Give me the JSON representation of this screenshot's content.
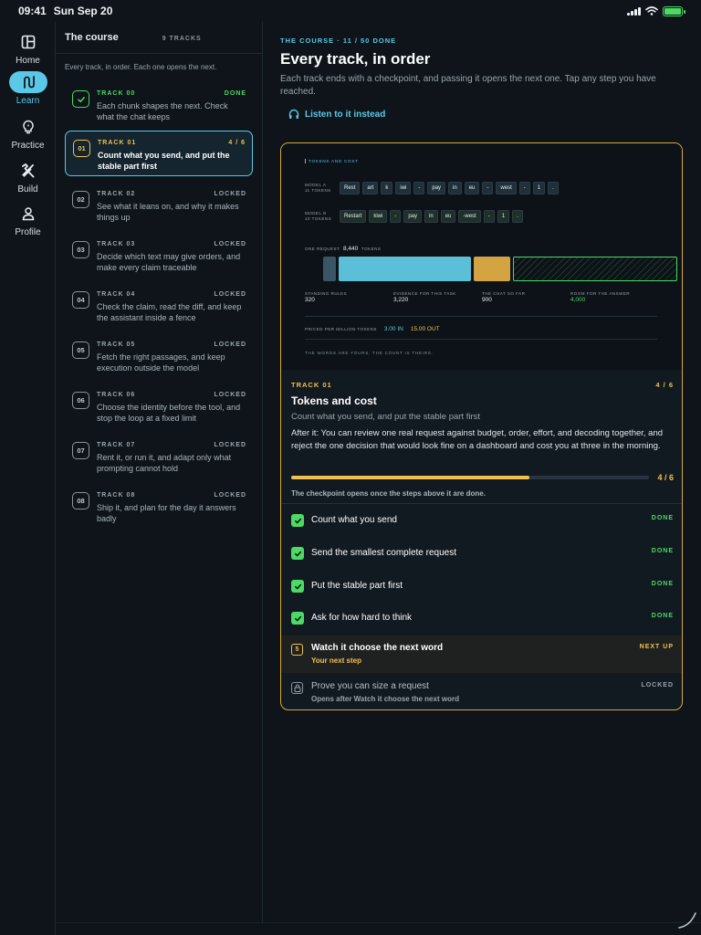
{
  "status": {
    "time": "09:41",
    "date": "Sun Sep 20"
  },
  "nav": [
    {
      "label": "Home",
      "icon": "layout-icon"
    },
    {
      "label": "Learn",
      "icon": "path-icon",
      "active": true
    },
    {
      "label": "Practice",
      "icon": "lightbulb-icon"
    },
    {
      "label": "Build",
      "icon": "tools-icon"
    },
    {
      "label": "Profile",
      "icon": "person-icon"
    }
  ],
  "course": {
    "title": "The course",
    "count": "9 TRACKS",
    "intro": "Every track, in order. Each one opens the next.",
    "tracks": [
      {
        "badge": "",
        "kicker": "TRACK 00",
        "state": "DONE",
        "desc": "Each chunk shapes the next. Check what the chat keeps",
        "status": "done"
      },
      {
        "badge": "01",
        "kicker": "TRACK 01",
        "state": "4 / 6",
        "desc": "Count what you send, and put the stable part first",
        "status": "current"
      },
      {
        "badge": "02",
        "kicker": "TRACK 02",
        "state": "LOCKED",
        "desc": "See what it leans on, and why it makes things up",
        "status": "locked"
      },
      {
        "badge": "03",
        "kicker": "TRACK 03",
        "state": "LOCKED",
        "desc": "Decide which text may give orders, and make every claim traceable",
        "status": "locked"
      },
      {
        "badge": "04",
        "kicker": "TRACK 04",
        "state": "LOCKED",
        "desc": "Check the claim, read the diff, and keep the assistant inside a fence",
        "status": "locked"
      },
      {
        "badge": "05",
        "kicker": "TRACK 05",
        "state": "LOCKED",
        "desc": "Fetch the right passages, and keep execution outside the model",
        "status": "locked"
      },
      {
        "badge": "06",
        "kicker": "TRACK 06",
        "state": "LOCKED",
        "desc": "Choose the identity before the tool, and stop the loop at a fixed limit",
        "status": "locked"
      },
      {
        "badge": "07",
        "kicker": "TRACK 07",
        "state": "LOCKED",
        "desc": "Rent it, or run it, and adapt only what prompting cannot hold",
        "status": "locked"
      },
      {
        "badge": "08",
        "kicker": "TRACK 08",
        "state": "LOCKED",
        "desc": "Ship it, and plan for the day it answers badly",
        "status": "locked"
      }
    ]
  },
  "main": {
    "eyebrow": "THE COURSE · 11 / 50 DONE",
    "title": "Every track, in order",
    "subtitle": "Each track ends with a checkpoint, and passing it opens the next one. Tap any step you have reached.",
    "listen": "Listen to it instead"
  },
  "illustration": {
    "title": "TOKENS AND COST",
    "model_a": {
      "label": "MODEL A",
      "count": "11 TOKENS",
      "tokens": [
        "Rest",
        "art",
        "k",
        "iwi",
        "-",
        "pay",
        "in",
        "eu",
        "-",
        "west",
        "-",
        "1",
        "."
      ]
    },
    "model_b": {
      "label": "MODEL B",
      "count": "10 TOKENS",
      "tokens": [
        "Restart",
        "kiwi",
        "-",
        "pay",
        "in",
        "eu",
        "-west",
        "-",
        "1",
        "."
      ]
    },
    "request_label": "ONE REQUEST",
    "request_total": "8,440",
    "request_unit": "TOKENS",
    "segments": [
      {
        "label": "STANDING RULES",
        "value": "320",
        "tokens": 320,
        "color": "#3a5566"
      },
      {
        "label": "EVIDENCE FOR THIS TASK",
        "value": "3,220",
        "tokens": 3220,
        "color": "#5bbfd8"
      },
      {
        "label": "THE CHAT SO FAR",
        "value": "900",
        "tokens": 900,
        "color": "#d4a442"
      },
      {
        "label": "ROOM FOR THE ANSWER",
        "value": "4,000",
        "tokens": 4000,
        "color": "#4cd964"
      }
    ],
    "price_label": "PRICED PER MILLION TOKENS",
    "price_in": "3.00 IN",
    "price_out": "15.00 OUT",
    "footer": "THE WORDS ARE YOURS. THE COUNT IS THEIRS."
  },
  "track": {
    "kicker": "TRACK 01",
    "progress": "4 / 6",
    "progress_fraction": 0.667,
    "title": "Tokens and cost",
    "subtitle": "Count what you send, and put the stable part first",
    "after": "After it: You can review one real request against budget, order, effort, and decoding together, and reject the one decision that would look fine on a dashboard and cost you at three in the morning.",
    "note": "The checkpoint opens once the steps above it are done.",
    "steps": [
      {
        "label": "Count what you send",
        "state": "DONE"
      },
      {
        "label": "Send the smallest complete request",
        "state": "DONE"
      },
      {
        "label": "Put the stable part first",
        "state": "DONE"
      },
      {
        "label": "Ask for how hard to think",
        "state": "DONE"
      }
    ],
    "next_step": {
      "num": "5",
      "label": "Watch it choose the next word",
      "hint": "Your next step",
      "state": "NEXT UP"
    },
    "locked_step": {
      "label": "Prove you can size a request",
      "hint": "Opens after Watch it choose the next word",
      "state": "LOCKED"
    }
  }
}
